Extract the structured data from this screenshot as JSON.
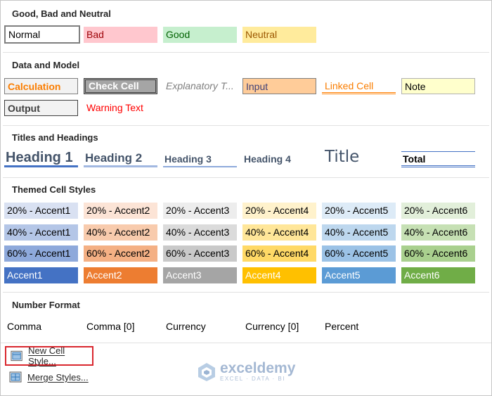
{
  "sections": {
    "good_bad": {
      "title": "Good, Bad and Neutral",
      "normal": "Normal",
      "bad": "Bad",
      "good": "Good",
      "neutral": "Neutral"
    },
    "data_model": {
      "title": "Data and Model",
      "calculation": "Calculation",
      "check_cell": "Check Cell",
      "explanatory": "Explanatory T...",
      "input": "Input",
      "linked_cell": "Linked Cell",
      "note": "Note",
      "output": "Output",
      "warning": "Warning Text"
    },
    "titles": {
      "title": "Titles and Headings",
      "heading1": "Heading 1",
      "heading2": "Heading 2",
      "heading3": "Heading 3",
      "heading4": "Heading 4",
      "title_style": "Title",
      "total": "Total"
    },
    "themed": {
      "title": "Themed Cell Styles",
      "rows": [
        [
          "20% - Accent1",
          "20% - Accent2",
          "20% - Accent3",
          "20% - Accent4",
          "20% - Accent5",
          "20% - Accent6"
        ],
        [
          "40% - Accent1",
          "40% - Accent2",
          "40% - Accent3",
          "40% - Accent4",
          "40% - Accent5",
          "40% - Accent6"
        ],
        [
          "60% - Accent1",
          "60% - Accent2",
          "60% - Accent3",
          "60% - Accent4",
          "60% - Accent5",
          "60% - Accent6"
        ],
        [
          "Accent1",
          "Accent2",
          "Accent3",
          "Accent4",
          "Accent5",
          "Accent6"
        ]
      ]
    },
    "number": {
      "title": "Number Format",
      "comma": "Comma",
      "comma0": "Comma [0]",
      "currency": "Currency",
      "currency0": "Currency [0]",
      "percent": "Percent"
    }
  },
  "menu": {
    "new_style": "New Cell Style...",
    "merge": "Merge Styles..."
  },
  "watermark": {
    "brand": "exceldemy",
    "tagline": "EXCEL · DATA · BI"
  },
  "colors": {
    "accent1": "#4472c4",
    "accent2": "#ed7d31",
    "accent3": "#a5a5a5",
    "accent4": "#ffc000",
    "accent5": "#5b9bd5",
    "accent6": "#70ad47",
    "highlight": "#d9272e"
  }
}
